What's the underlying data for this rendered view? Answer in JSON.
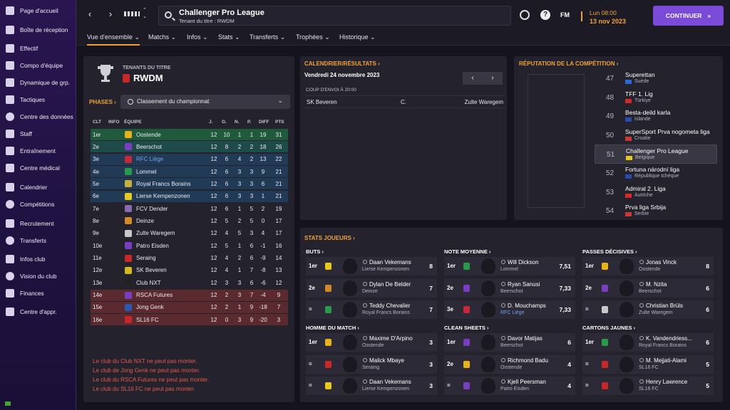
{
  "sidebar": {
    "items": [
      {
        "label": "Page d'accueil",
        "icon": "home-icon"
      },
      {
        "label": "Boîte de réception",
        "icon": "inbox-icon"
      },
      {
        "label": "Effectif",
        "icon": "shirt-icon"
      },
      {
        "label": "Compo d'équipe",
        "icon": "team-lineup-icon"
      },
      {
        "label": "Dynamique de grp.",
        "icon": "dynamics-icon"
      },
      {
        "label": "Tactiques",
        "icon": "tactics-icon"
      },
      {
        "label": "Centre des données",
        "icon": "data-hub-icon"
      },
      {
        "label": "Staff",
        "icon": "staff-icon"
      },
      {
        "label": "Entraînement",
        "icon": "training-icon"
      },
      {
        "label": "Centre médical",
        "icon": "medical-icon"
      },
      {
        "label": "Calendrier",
        "icon": "calendar-icon"
      },
      {
        "label": "Compétitions",
        "icon": "trophy-icon"
      },
      {
        "label": "Recrutement",
        "icon": "scouting-icon"
      },
      {
        "label": "Transferts",
        "icon": "transfers-icon"
      },
      {
        "label": "Infos club",
        "icon": "club-info-icon"
      },
      {
        "label": "Vision du club",
        "icon": "club-vision-icon"
      },
      {
        "label": "Finances",
        "icon": "finances-icon"
      },
      {
        "label": "Centre d'appr.",
        "icon": "learning-icon"
      }
    ]
  },
  "header": {
    "title": "Challenger Pro League",
    "subtitle": "Tenant du titre : RWDM",
    "fm_label": "FM",
    "date_time": "Lun 08:00",
    "date_day": "13 nov 2023",
    "continue_label": "CONTINUER"
  },
  "tabs": [
    {
      "label": "Vue d'ensemble"
    },
    {
      "label": "Matchs"
    },
    {
      "label": "Infos"
    },
    {
      "label": "Stats"
    },
    {
      "label": "Transferts"
    },
    {
      "label": "Trophées"
    },
    {
      "label": "Historique"
    }
  ],
  "holders": {
    "label": "TENANTS DU TITRE",
    "team": "RWDM"
  },
  "phases": {
    "label": "PHASES",
    "value": "Classement du championnat"
  },
  "table": {
    "headers": [
      "CLT",
      "INFO",
      "ÉQUIPE",
      "J.",
      "G.",
      "N.",
      "P.",
      "DIFF",
      "PTS"
    ],
    "rows": [
      {
        "pos": "1er",
        "team": "Oostende",
        "j": "12",
        "g": "10",
        "n": "1",
        "p": "1",
        "diff": "19",
        "pts": "31",
        "zone": "#1f5a3c",
        "crest": "#e8b21a"
      },
      {
        "pos": "2e",
        "team": "Beerschot",
        "j": "12",
        "g": "8",
        "n": "2",
        "p": "2",
        "diff": "18",
        "pts": "26",
        "zone": "#1e4a4a",
        "crest": "#7a3fc0"
      },
      {
        "pos": "3e",
        "team": "RFC Liège",
        "j": "12",
        "g": "6",
        "n": "4",
        "p": "2",
        "diff": "13",
        "pts": "22",
        "zone": "#213b56",
        "crest": "#c8283a",
        "link": true
      },
      {
        "pos": "4e",
        "team": "Lommel",
        "j": "12",
        "g": "6",
        "n": "3",
        "p": "3",
        "diff": "9",
        "pts": "21",
        "zone": "#213b56",
        "crest": "#2a9a4a"
      },
      {
        "pos": "5e",
        "team": "Royal Francs Borains",
        "j": "12",
        "g": "6",
        "n": "3",
        "p": "3",
        "diff": "6",
        "pts": "21",
        "zone": "#213b56",
        "crest": "#c8b03a"
      },
      {
        "pos": "6e",
        "team": "Lierse Kempenzonen",
        "j": "12",
        "g": "6",
        "n": "3",
        "p": "3",
        "diff": "1",
        "pts": "21",
        "zone": "#213b56",
        "crest": "#e8c81a"
      },
      {
        "pos": "7e",
        "team": "FCV Dender",
        "j": "12",
        "g": "6",
        "n": "1",
        "p": "5",
        "diff": "2",
        "pts": "19",
        "zone": "",
        "crest": "#8a6ab0"
      },
      {
        "pos": "8e",
        "team": "Deinze",
        "j": "12",
        "g": "5",
        "n": "2",
        "p": "5",
        "diff": "0",
        "pts": "17",
        "zone": "",
        "crest": "#d08a2a"
      },
      {
        "pos": "9e",
        "team": "Zulte Waregem",
        "j": "12",
        "g": "4",
        "n": "5",
        "p": "3",
        "diff": "4",
        "pts": "17",
        "zone": "",
        "crest": "#c8c8c8"
      },
      {
        "pos": "10e",
        "team": "Patro Eisden",
        "j": "12",
        "g": "5",
        "n": "1",
        "p": "6",
        "diff": "-1",
        "pts": "16",
        "zone": "",
        "crest": "#7a3fc0"
      },
      {
        "pos": "11e",
        "team": "Seraing",
        "j": "12",
        "g": "4",
        "n": "2",
        "p": "6",
        "diff": "-9",
        "pts": "14",
        "zone": "",
        "crest": "#c82828"
      },
      {
        "pos": "12e",
        "team": "SK Beveren",
        "j": "12",
        "g": "4",
        "n": "1",
        "p": "7",
        "diff": "-8",
        "pts": "13",
        "zone": "",
        "crest": "#d8b81a"
      },
      {
        "pos": "13e",
        "team": "Club NXT",
        "j": "12",
        "g": "3",
        "n": "3",
        "p": "6",
        "diff": "-6",
        "pts": "12",
        "zone": "",
        "crest": "#222222"
      },
      {
        "pos": "14e",
        "team": "RSCA Futures",
        "j": "12",
        "g": "2",
        "n": "3",
        "p": "7",
        "diff": "-4",
        "pts": "9",
        "zone": "#5a2a2e",
        "crest": "#7a3fc0"
      },
      {
        "pos": "15e",
        "team": "Jong Genk",
        "j": "12",
        "g": "2",
        "n": "1",
        "p": "9",
        "diff": "-18",
        "pts": "7",
        "zone": "#5a2a2e",
        "crest": "#2a5ab0"
      },
      {
        "pos": "16e",
        "team": "SL16 FC",
        "j": "12",
        "g": "0",
        "n": "3",
        "p": "9",
        "diff": "-20",
        "pts": "3",
        "zone": "#5a2a2e",
        "crest": "#c82828"
      }
    ],
    "notes": [
      "Le club du Club NXT ne peut pas monter.",
      "Le club de Jong Genk ne peut pas monter.",
      "Le club du RSCA Futures ne peut pas monter.",
      "Le club du SL16 FC ne peut pas monter."
    ]
  },
  "fixtures": {
    "title": "CALENDRIER/RÉSULTATS",
    "date": "Vendredi 24 novembre 2023",
    "kickoff": "COUP D'ENVOI À 20:00",
    "home": "SK Beveren",
    "mid": "C.",
    "away": "Zulte Waregem"
  },
  "reputation": {
    "title": "RÉPUTATION DE LA COMPÉTITION",
    "rows": [
      {
        "rank": "47",
        "name": "Superettan",
        "country": "Suède",
        "flag": "#2a6ad8"
      },
      {
        "rank": "48",
        "name": "TFF 1. Lig",
        "country": "Türkiye",
        "flag": "#d82828"
      },
      {
        "rank": "49",
        "name": "Besta-deild karla",
        "country": "Islande",
        "flag": "#2a4ab0"
      },
      {
        "rank": "50",
        "name": "SuperSport Prva nogometa liga",
        "country": "Croatie",
        "flag": "#c83a3a"
      },
      {
        "rank": "51",
        "name": "Challenger Pro League",
        "country": "Belgique",
        "flag": "#e8c81a",
        "selected": true
      },
      {
        "rank": "52",
        "name": "Fortuna národní liga",
        "country": "République tchèque",
        "flag": "#2a4ab0"
      },
      {
        "rank": "53",
        "name": "Admiral 2. Liga",
        "country": "Autriche",
        "flag": "#d82828"
      },
      {
        "rank": "54",
        "name": "Prva liga Srbija",
        "country": "Serbie",
        "flag": "#c83a3a"
      }
    ]
  },
  "stats": {
    "title": "STATS JOUEURS",
    "groups": [
      {
        "title": "BUTS",
        "rows": [
          {
            "rank": "1er",
            "name": "Daan Vekemans",
            "club": "Lierse Kempenzonen",
            "value": "8",
            "crest": "#e8c81a"
          },
          {
            "rank": "2e",
            "name": "Dylan De Belder",
            "club": "Deinze",
            "value": "7",
            "crest": "#d08a2a"
          },
          {
            "rank": "=",
            "name": "Teddy Chevalier",
            "club": "Royal Francs Borains",
            "value": "7",
            "crest": "#2a9a4a"
          }
        ]
      },
      {
        "title": "NOTE MOYENNE",
        "rows": [
          {
            "rank": "1er",
            "name": "Will Dickson",
            "club": "Lommel",
            "value": "7,51",
            "crest": "#2a9a4a"
          },
          {
            "rank": "2e",
            "name": "Ryan Sanusi",
            "club": "Beerschot",
            "value": "7,33",
            "crest": "#7a3fc0"
          },
          {
            "rank": "3e",
            "name": "D. Mouchamps",
            "club": "RFC Liège",
            "value": "7,33",
            "crest": "#c8283a",
            "link": true
          }
        ]
      },
      {
        "title": "PASSES DÉCISIVES",
        "rows": [
          {
            "rank": "1er",
            "name": "Jonas Vinck",
            "club": "Oostende",
            "value": "8",
            "crest": "#e8b21a"
          },
          {
            "rank": "2e",
            "name": "M. Nzita",
            "club": "Beerschot",
            "value": "6",
            "crest": "#7a3fc0"
          },
          {
            "rank": "=",
            "name": "Christian Brüls",
            "club": "Zulte Waregem",
            "value": "6",
            "crest": "#c8c8c8"
          }
        ]
      },
      {
        "title": "HOMME DU MATCH",
        "rows": [
          {
            "rank": "1er",
            "name": "Maxime D'Arpino",
            "club": "Oostende",
            "value": "3",
            "crest": "#e8b21a"
          },
          {
            "rank": "=",
            "name": "Malick Mbaye",
            "club": "Seraing",
            "value": "3",
            "crest": "#c82828"
          },
          {
            "rank": "=",
            "name": "Daan Vekemans",
            "club": "Lierse Kempenzonen",
            "value": "3",
            "crest": "#e8c81a"
          }
        ]
      },
      {
        "title": "CLEAN SHEETS",
        "rows": [
          {
            "rank": "1er",
            "name": "Davor Matijas",
            "club": "Beerschot",
            "value": "6",
            "crest": "#7a3fc0"
          },
          {
            "rank": "2e",
            "name": "Richmond Badu",
            "club": "Oostende",
            "value": "4",
            "crest": "#e8b21a"
          },
          {
            "rank": "=",
            "name": "Kjell Peersman",
            "club": "Patro Eisden",
            "value": "4",
            "crest": "#7a3fc0"
          }
        ]
      },
      {
        "title": "CARTONS JAUNES",
        "rows": [
          {
            "rank": "1er",
            "name": "K. Vandendriess...",
            "club": "Royal Francs Borains",
            "value": "6",
            "crest": "#2a9a4a"
          },
          {
            "rank": "=",
            "name": "M. Mejjati-Alami",
            "club": "SL16 FC",
            "value": "5",
            "crest": "#c82828"
          },
          {
            "rank": "=",
            "name": "Henry Lawrence",
            "club": "SL16 FC",
            "value": "5",
            "crest": "#c82828"
          }
        ]
      }
    ]
  },
  "colors": {
    "accent": "#f0a33a",
    "primary": "#7b4ad8",
    "link": "#6fa4ea",
    "warning": "#e25b4d"
  }
}
